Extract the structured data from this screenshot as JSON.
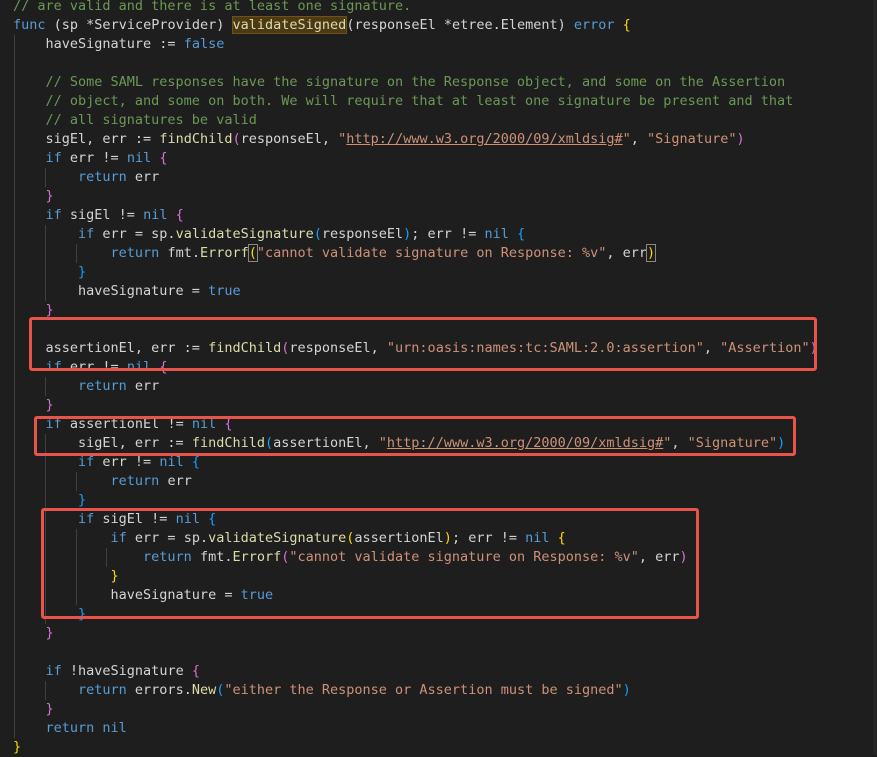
{
  "editor": {
    "language": "go",
    "colors": {
      "background": "#1e1e1e",
      "keyword": "#569cd6",
      "function": "#dcdcaa",
      "string": "#ce9178",
      "comment": "#6a9955",
      "type": "#4ec9b0",
      "text": "#d4d4d4",
      "annotation": "#e8534a"
    },
    "lines": [
      {
        "tokens": [
          {
            "t": "// are valid and there is at least one signature.",
            "c": "cm"
          }
        ]
      },
      {
        "tokens": [
          {
            "t": "func",
            "c": "kw"
          },
          {
            "t": " ",
            "c": "plain"
          },
          {
            "t": "(",
            "c": "plain"
          },
          {
            "t": "sp *ServiceProvider",
            "c": "plain"
          },
          {
            "t": ")",
            "c": "plain"
          },
          {
            "t": " ",
            "c": "plain"
          },
          {
            "t": "validateSigned",
            "c": "fn hl"
          },
          {
            "t": "(responseEl *etree.Element) ",
            "c": "plain"
          },
          {
            "t": "error",
            "c": "kw"
          },
          {
            "t": " ",
            "c": "plain"
          },
          {
            "t": "{",
            "c": "b1"
          }
        ]
      },
      {
        "tokens": [
          {
            "t": "    haveSignature := ",
            "c": "plain"
          },
          {
            "t": "false",
            "c": "kw"
          }
        ]
      },
      {
        "tokens": []
      },
      {
        "tokens": [
          {
            "t": "    // Some SAML responses have the signature on the Response object, and some on the Assertion",
            "c": "cm"
          }
        ]
      },
      {
        "tokens": [
          {
            "t": "    // object, and some on both. We will require that at least one signature be present and that",
            "c": "cm"
          }
        ]
      },
      {
        "tokens": [
          {
            "t": "    // all signatures be valid",
            "c": "cm"
          }
        ]
      },
      {
        "tokens": [
          {
            "t": "    sigEl, err := ",
            "c": "plain"
          },
          {
            "t": "findChild",
            "c": "fn"
          },
          {
            "t": "(",
            "c": "b2"
          },
          {
            "t": "responseEl, ",
            "c": "plain"
          },
          {
            "t": "\"",
            "c": "str"
          },
          {
            "t": "http://www.w3.org/2000/09/xmldsig#",
            "c": "url"
          },
          {
            "t": "\"",
            "c": "str"
          },
          {
            "t": ", ",
            "c": "plain"
          },
          {
            "t": "\"Signature\"",
            "c": "str"
          },
          {
            "t": ")",
            "c": "b2"
          }
        ]
      },
      {
        "tokens": [
          {
            "t": "    if",
            "c": "kw"
          },
          {
            "t": " err != ",
            "c": "plain"
          },
          {
            "t": "nil",
            "c": "kw"
          },
          {
            "t": " ",
            "c": "plain"
          },
          {
            "t": "{",
            "c": "b2"
          }
        ]
      },
      {
        "tokens": [
          {
            "t": "        return",
            "c": "kw"
          },
          {
            "t": " err",
            "c": "plain"
          }
        ]
      },
      {
        "tokens": [
          {
            "t": "    }",
            "c": "b2"
          }
        ]
      },
      {
        "tokens": [
          {
            "t": "    if",
            "c": "kw"
          },
          {
            "t": " sigEl != ",
            "c": "plain"
          },
          {
            "t": "nil",
            "c": "kw"
          },
          {
            "t": " ",
            "c": "plain"
          },
          {
            "t": "{",
            "c": "b2"
          }
        ]
      },
      {
        "tokens": [
          {
            "t": "        if",
            "c": "kw"
          },
          {
            "t": " err = sp.",
            "c": "plain"
          },
          {
            "t": "validateSignature",
            "c": "fn"
          },
          {
            "t": "(",
            "c": "b3"
          },
          {
            "t": "responseEl",
            "c": "plain"
          },
          {
            "t": ")",
            "c": "b3"
          },
          {
            "t": "; err != ",
            "c": "plain"
          },
          {
            "t": "nil",
            "c": "kw"
          },
          {
            "t": " ",
            "c": "plain"
          },
          {
            "t": "{",
            "c": "b3"
          }
        ]
      },
      {
        "tokens": [
          {
            "t": "            return",
            "c": "kw"
          },
          {
            "t": " fmt.",
            "c": "plain"
          },
          {
            "t": "Errorf",
            "c": "fn"
          },
          {
            "t": "(",
            "c": "b1 bm"
          },
          {
            "t": "\"cannot validate signature on Response: %v\"",
            "c": "str"
          },
          {
            "t": ", err",
            "c": "plain"
          },
          {
            "t": ")",
            "c": "b1 bm"
          }
        ]
      },
      {
        "tokens": [
          {
            "t": "        }",
            "c": "b3"
          }
        ]
      },
      {
        "tokens": [
          {
            "t": "        haveSignature = ",
            "c": "plain"
          },
          {
            "t": "true",
            "c": "kw"
          }
        ]
      },
      {
        "tokens": [
          {
            "t": "    }",
            "c": "b2"
          }
        ]
      },
      {
        "tokens": []
      },
      {
        "tokens": [
          {
            "t": "    assertionEl, err := ",
            "c": "plain"
          },
          {
            "t": "findChild",
            "c": "fn"
          },
          {
            "t": "(",
            "c": "b2"
          },
          {
            "t": "responseEl, ",
            "c": "plain"
          },
          {
            "t": "\"urn:oasis:names:tc:SAML:2.0:assertion\"",
            "c": "str"
          },
          {
            "t": ", ",
            "c": "plain"
          },
          {
            "t": "\"Assertion\"",
            "c": "str"
          },
          {
            "t": ")",
            "c": "b2"
          }
        ]
      },
      {
        "tokens": [
          {
            "t": "    if",
            "c": "kw"
          },
          {
            "t": " err != ",
            "c": "plain"
          },
          {
            "t": "nil",
            "c": "kw"
          },
          {
            "t": " ",
            "c": "plain"
          },
          {
            "t": "{",
            "c": "b2"
          }
        ]
      },
      {
        "tokens": [
          {
            "t": "        return",
            "c": "kw"
          },
          {
            "t": " err",
            "c": "plain"
          }
        ]
      },
      {
        "tokens": [
          {
            "t": "    }",
            "c": "b2"
          }
        ]
      },
      {
        "tokens": [
          {
            "t": "    if",
            "c": "kw"
          },
          {
            "t": " assertionEl != ",
            "c": "plain"
          },
          {
            "t": "nil",
            "c": "kw"
          },
          {
            "t": " ",
            "c": "plain"
          },
          {
            "t": "{",
            "c": "b2"
          }
        ]
      },
      {
        "tokens": [
          {
            "t": "        sigEl, err := ",
            "c": "plain"
          },
          {
            "t": "findChild",
            "c": "fn"
          },
          {
            "t": "(",
            "c": "b3"
          },
          {
            "t": "assertionEl, ",
            "c": "plain"
          },
          {
            "t": "\"",
            "c": "str"
          },
          {
            "t": "http://www.w3.org/2000/09/xmldsig#",
            "c": "url"
          },
          {
            "t": "\"",
            "c": "str"
          },
          {
            "t": ", ",
            "c": "plain"
          },
          {
            "t": "\"Signature\"",
            "c": "str"
          },
          {
            "t": ")",
            "c": "b3"
          }
        ]
      },
      {
        "tokens": [
          {
            "t": "        if",
            "c": "kw"
          },
          {
            "t": " err != ",
            "c": "plain"
          },
          {
            "t": "nil",
            "c": "kw"
          },
          {
            "t": " ",
            "c": "plain"
          },
          {
            "t": "{",
            "c": "b3"
          }
        ]
      },
      {
        "tokens": [
          {
            "t": "            return",
            "c": "kw"
          },
          {
            "t": " err",
            "c": "plain"
          }
        ]
      },
      {
        "tokens": [
          {
            "t": "        }",
            "c": "b3"
          }
        ]
      },
      {
        "tokens": [
          {
            "t": "        if",
            "c": "kw"
          },
          {
            "t": " sigEl != ",
            "c": "plain"
          },
          {
            "t": "nil",
            "c": "kw"
          },
          {
            "t": " ",
            "c": "plain"
          },
          {
            "t": "{",
            "c": "b3"
          }
        ]
      },
      {
        "tokens": [
          {
            "t": "            if",
            "c": "kw"
          },
          {
            "t": " err = sp.",
            "c": "plain"
          },
          {
            "t": "validateSignature",
            "c": "fn"
          },
          {
            "t": "(",
            "c": "b1"
          },
          {
            "t": "assertionEl",
            "c": "plain"
          },
          {
            "t": ")",
            "c": "b1"
          },
          {
            "t": "; err != ",
            "c": "plain"
          },
          {
            "t": "nil",
            "c": "kw"
          },
          {
            "t": " ",
            "c": "plain"
          },
          {
            "t": "{",
            "c": "b1"
          }
        ]
      },
      {
        "tokens": [
          {
            "t": "                return",
            "c": "kw"
          },
          {
            "t": " fmt.",
            "c": "plain"
          },
          {
            "t": "Errorf",
            "c": "fn"
          },
          {
            "t": "(",
            "c": "b2"
          },
          {
            "t": "\"cannot validate signature on Response: %v\"",
            "c": "str"
          },
          {
            "t": ", err",
            "c": "plain"
          },
          {
            "t": ")",
            "c": "b2"
          }
        ]
      },
      {
        "tokens": [
          {
            "t": "            }",
            "c": "b1"
          }
        ]
      },
      {
        "tokens": [
          {
            "t": "            haveSignature = ",
            "c": "plain"
          },
          {
            "t": "true",
            "c": "kw"
          }
        ]
      },
      {
        "tokens": [
          {
            "t": "        }",
            "c": "b3"
          }
        ]
      },
      {
        "tokens": [
          {
            "t": "    }",
            "c": "b2"
          }
        ]
      },
      {
        "tokens": []
      },
      {
        "tokens": [
          {
            "t": "    if",
            "c": "kw"
          },
          {
            "t": " !haveSignature ",
            "c": "plain"
          },
          {
            "t": "{",
            "c": "b2"
          }
        ]
      },
      {
        "tokens": [
          {
            "t": "        return",
            "c": "kw"
          },
          {
            "t": " errors.",
            "c": "plain"
          },
          {
            "t": "New",
            "c": "fn"
          },
          {
            "t": "(",
            "c": "b3"
          },
          {
            "t": "\"either the Response or Assertion must be signed\"",
            "c": "str"
          },
          {
            "t": ")",
            "c": "b3"
          }
        ]
      },
      {
        "tokens": [
          {
            "t": "    }",
            "c": "b2"
          }
        ]
      },
      {
        "tokens": [
          {
            "t": "    return",
            "c": "kw"
          },
          {
            "t": " ",
            "c": "plain"
          },
          {
            "t": "nil",
            "c": "kw"
          }
        ]
      },
      {
        "tokens": [
          {
            "t": "}",
            "c": "b1"
          }
        ]
      }
    ]
  }
}
